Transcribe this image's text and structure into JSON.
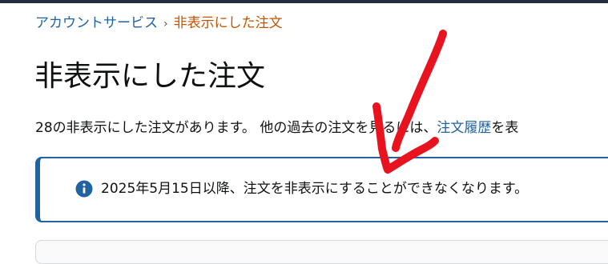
{
  "breadcrumb": {
    "parent": "アカウントサービス",
    "separator": "›",
    "current": "非表示にした注文"
  },
  "page": {
    "title": "非表示にした注文"
  },
  "summary": {
    "text": "28の非表示にした注文があります。 他の過去の注文を見るには、",
    "link": "注文履歴",
    "suffix": "を表"
  },
  "alert": {
    "icon": "info-icon",
    "message": "2025年5月15日以降、注文を非表示にすることができなくなります。"
  },
  "annotation": {
    "icon": "red-arrow",
    "color": "#e8131f"
  },
  "colors": {
    "link": "#2162a1",
    "current_crumb": "#c45500",
    "alert_border": "#2162a1",
    "top_bar": "#232f3e"
  }
}
